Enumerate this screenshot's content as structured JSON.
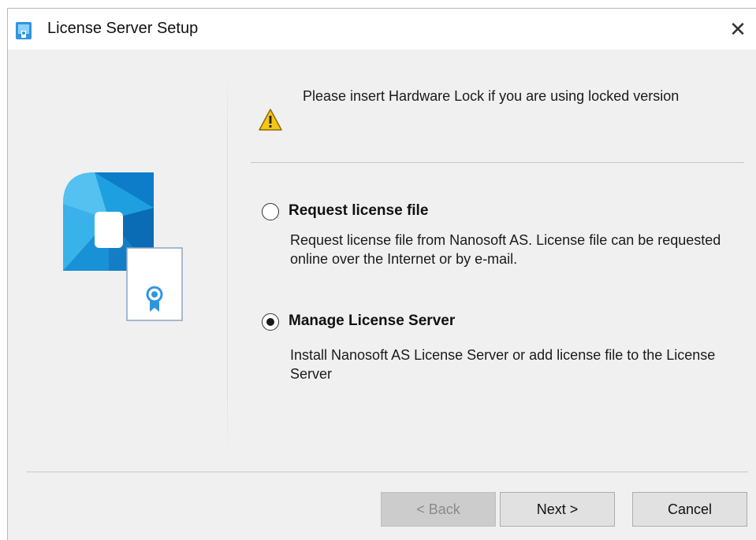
{
  "window": {
    "title": "License Server Setup",
    "close_glyph": "✕",
    "icon": "setup-app-icon"
  },
  "notice": {
    "icon": "warning-icon",
    "text": "Please insert Hardware Lock if you are using locked version"
  },
  "options": [
    {
      "label": "Request license file",
      "description": "Request license file from Nanosoft AS. License file can be requested online over the Internet or by e-mail.",
      "selected": false
    },
    {
      "label": "Manage License Server",
      "description": "Install Nanosoft AS License Server or add license file to the License Server",
      "selected": true
    }
  ],
  "buttons": {
    "back": "< Back",
    "back_enabled": false,
    "next": "Next >",
    "cancel": "Cancel"
  },
  "colors": {
    "window_bg": "#f0f0f0",
    "accent_blue": "#1e88d8",
    "warning_yellow": "#f5c518"
  }
}
